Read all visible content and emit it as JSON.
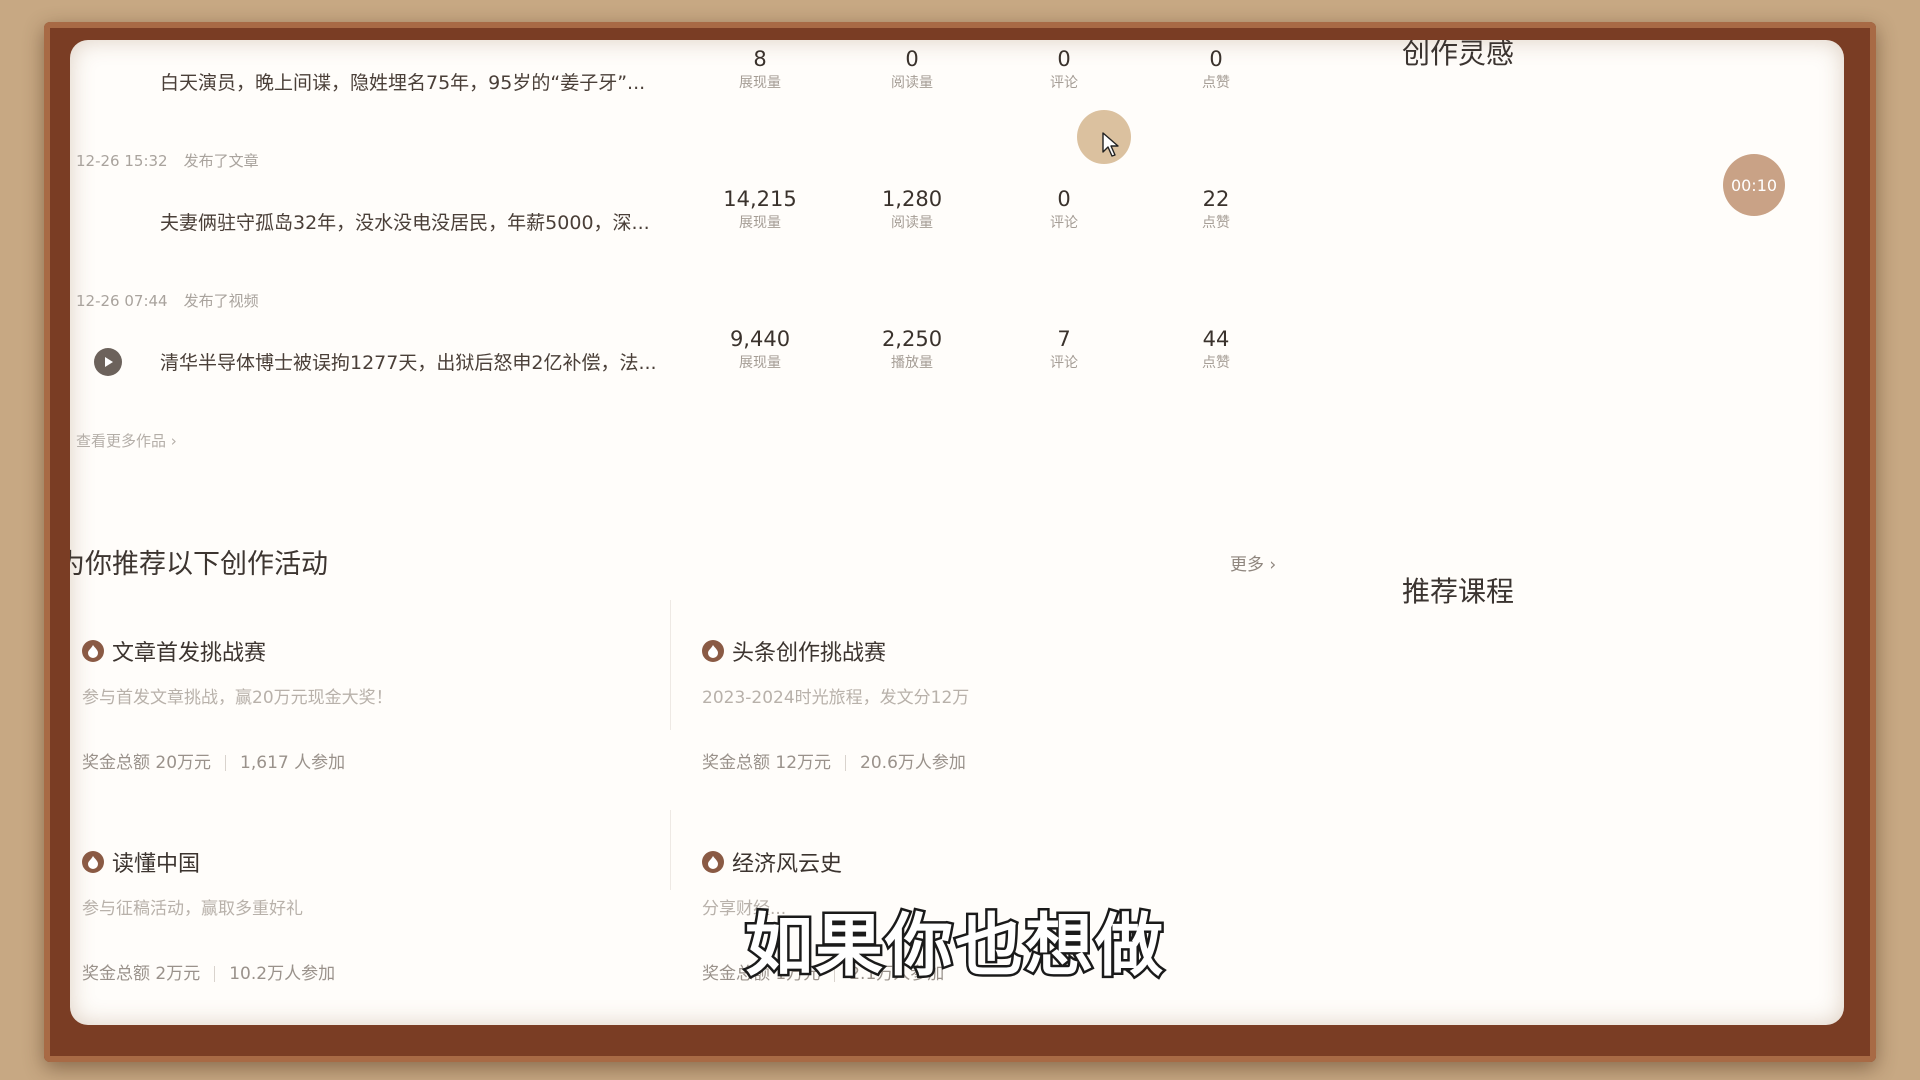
{
  "works": [
    {
      "meta_time": "",
      "meta_action": "",
      "title": "白天演员，晚上间谍，隐姓埋名75年，95岁的“姜子牙”...",
      "is_video": false,
      "stats": [
        {
          "value": "8",
          "label": "展现量"
        },
        {
          "value": "0",
          "label": "阅读量"
        },
        {
          "value": "0",
          "label": "评论"
        },
        {
          "value": "0",
          "label": "点赞"
        }
      ]
    },
    {
      "meta_time": "12-26 15:32",
      "meta_action": "发布了文章",
      "title": "夫妻俩驻守孤岛32年，没水没电没居民，年薪5000，深...",
      "is_video": false,
      "stats": [
        {
          "value": "14,215",
          "label": "展现量"
        },
        {
          "value": "1,280",
          "label": "阅读量"
        },
        {
          "value": "0",
          "label": "评论"
        },
        {
          "value": "22",
          "label": "点赞"
        }
      ]
    },
    {
      "meta_time": "12-26 07:44",
      "meta_action": "发布了视频",
      "title": "清华半导体博士被误拘1277天，出狱后怒申2亿补偿，法...",
      "is_video": true,
      "stats": [
        {
          "value": "9,440",
          "label": "展现量"
        },
        {
          "value": "2,250",
          "label": "播放量"
        },
        {
          "value": "7",
          "label": "评论"
        },
        {
          "value": "44",
          "label": "点赞"
        }
      ]
    }
  ],
  "view_more_works": "查看更多作品 ›",
  "activities_section": {
    "title": "为你推荐以下创作活动",
    "more": "更多 ›",
    "cards": [
      {
        "title": "文章首发挑战赛",
        "desc": "参与首发文章挑战，赢20万元现金大奖！",
        "prize": "奖金总额 20万元",
        "participants": "1,617 人参加"
      },
      {
        "title": "头条创作挑战赛",
        "desc": "2023-2024时光旅程，发文分12万",
        "prize": "奖金总额 12万元",
        "participants": "20.6万人参加"
      },
      {
        "title": "读懂中国",
        "desc": "参与征稿活动，赢取多重好礼",
        "prize": "奖金总额 2万元",
        "participants": "10.2万人参加"
      },
      {
        "title": "经济风云史",
        "desc": "分享财经...",
        "prize": "奖金总额 1万元",
        "participants": "2.1万人参加"
      }
    ]
  },
  "sidebar": {
    "inspiration_title": "创作灵感",
    "courses_title": "推荐课程"
  },
  "timer": "00:10",
  "subtitle": "如果你也想做",
  "colors": {
    "frame": "#7a3d24",
    "background": "#c7a883",
    "timer": "#c9a286",
    "fire_icon": "#8a5a44"
  }
}
